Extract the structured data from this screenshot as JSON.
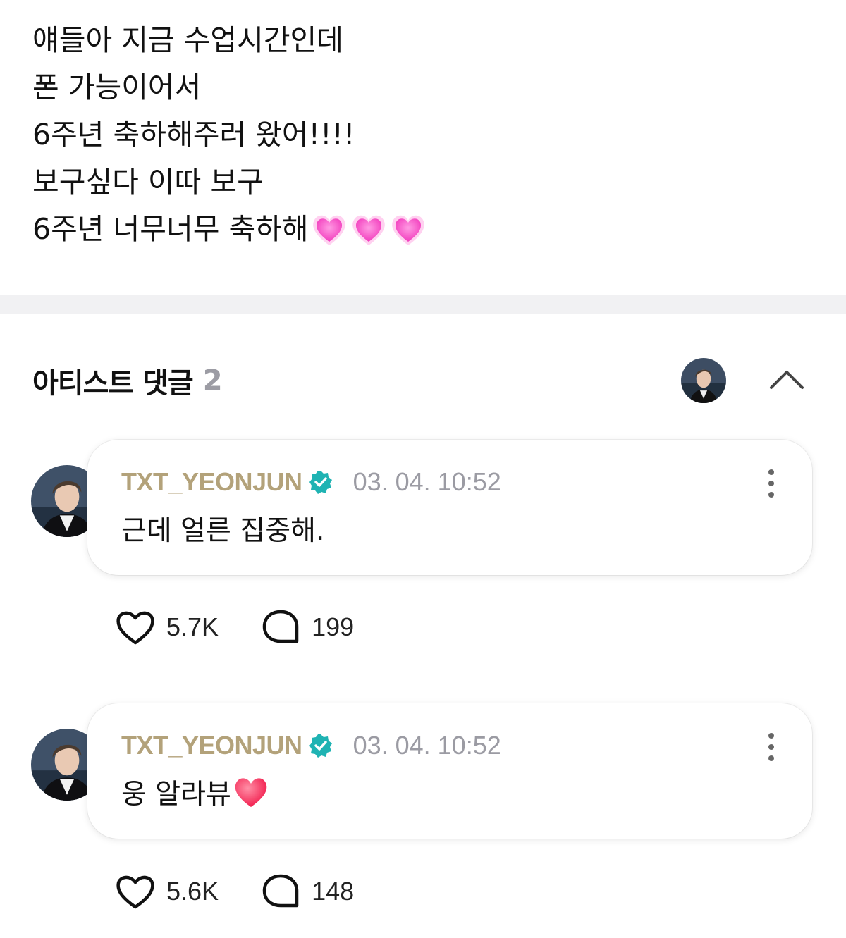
{
  "post": {
    "lines": [
      "얘들아 지금 수업시간인데",
      "폰 가능이어서",
      "6주년 축하해주러 왔어!!!!",
      "보구싶다 이따 보구",
      "6주년 너무너무 축하해"
    ],
    "trailing_emoji": "pink-growing-heart-icon ×3"
  },
  "comments_section": {
    "title": "아티스트 댓글",
    "count": "2"
  },
  "comments": [
    {
      "author": "TXT_YEONJUN",
      "timestamp": "03. 04. 10:52",
      "text": "근데 얼른 집중해.",
      "likes": "5.7K",
      "replies": "199"
    },
    {
      "author": "TXT_YEONJUN",
      "timestamp": "03. 04. 10:52",
      "text": "웅 알라뷰",
      "likes": "5.6K",
      "replies": "148"
    }
  ],
  "colors": {
    "author_gold": "#b3a27a",
    "verified_teal": "#1fb3b3",
    "meta_gray": "#9b9ba3",
    "pink_heart": "#ff5fc8",
    "red_heart": "#ff2d55"
  }
}
